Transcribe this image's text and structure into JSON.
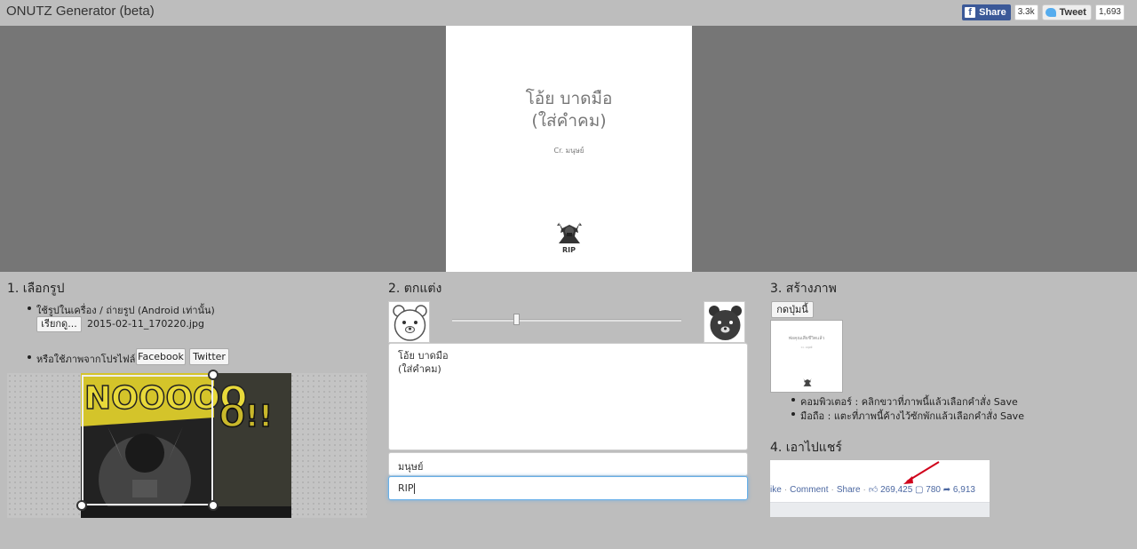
{
  "app": {
    "title": "ONUTZ Generator (beta)"
  },
  "social": {
    "share_label": "Share",
    "share_count": "3.3k",
    "tweet_label": "Tweet",
    "tweet_count": "1,693"
  },
  "preview": {
    "text": "โอ้ย บาดมือ\n(ใส่คำคม)",
    "credit": "Cr. มนุษย์",
    "stamp": "RIP"
  },
  "step1": {
    "title": "1. เลือกรูป",
    "option_upload_label": "ใช้รูปในเครื่อง / ถ่ายรูป (Android เท่านั้น)",
    "browse_button": "เรียกดู...",
    "file_name": "2015-02-11_170220.jpg",
    "option_profile_label": "หรือใช้ภาพจากโปรไฟล์",
    "facebook_button": "Facebook",
    "twitter_button": "Twitter"
  },
  "step2": {
    "title": "2. ตกแต่ง",
    "quote_text": "โอ้ย บาดมือ\n(ใส่คำคม)",
    "credit_value": "มนุษย์",
    "stamp_value": "RIP",
    "slider_value": 0.28
  },
  "step3": {
    "title": "3. สร้างภาพ",
    "create_button": "กดปุ่มนี้",
    "thumb_text": "พ่อคุณเสียชีวิตแล้ว",
    "instruction_desktop": "คอมพิวเตอร์ : คลิกขวาที่ภาพนี้แล้วเลือกคำสั่ง Save",
    "instruction_mobile": "มือถือ : แตะที่ภาพนี้ค้างไว้ซักพักแล้วเลือกคำสั่ง Save"
  },
  "step4": {
    "title": "4. เอาไปแชร์",
    "like_link": "ike",
    "comment_link": "Comment",
    "share_link": "Share",
    "likes": "269,425",
    "comments": "780",
    "shares": "6,913"
  },
  "colors": {
    "stage_bg": "#767676",
    "page_bg": "#bdbdbd",
    "facebook": "#3b5998",
    "focus": "#66afe9",
    "arrow": "#d0021b"
  }
}
